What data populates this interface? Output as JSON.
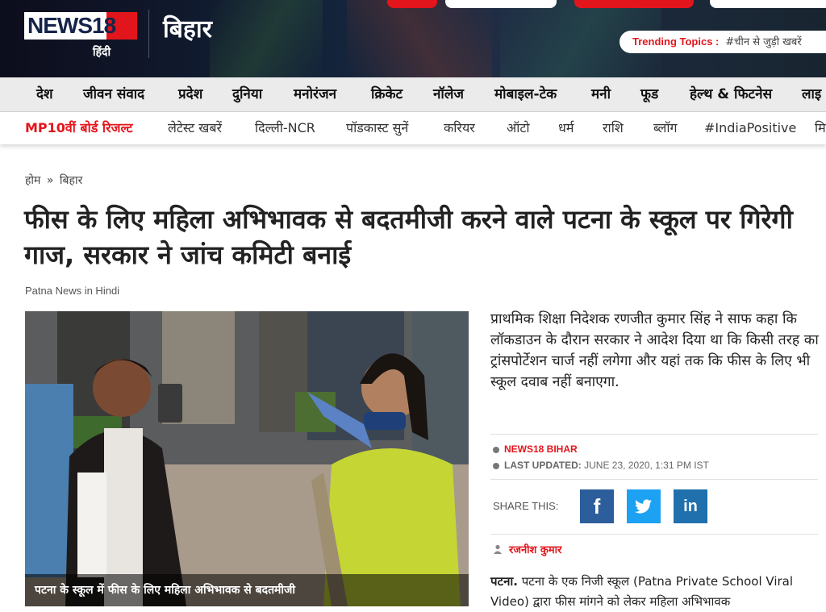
{
  "header": {
    "logo_text": "NEWS18",
    "logo_sub": "हिंदी",
    "section_title": "बिहार",
    "trending_label": "Trending Topics :",
    "trending_text": "#चीन से जुड़ी खबरें"
  },
  "nav_primary": [
    "देश",
    "जीवन संवाद",
    "प्रदेश",
    "दुनिया",
    "मनोरंजन",
    "क्रिकेट",
    "नॉलेज",
    "मोबाइल-टेक",
    "मनी",
    "फूड",
    "हेल्थ & फिटनेस",
    "लाइ"
  ],
  "nav_secondary": [
    "MP10वीं बोर्ड रिजल्ट",
    "लेटेस्ट खबरें",
    "दिल्ली-NCR",
    "पॉडकास्ट सुनें",
    "करियर",
    "ऑटो",
    "धर्म",
    "राशि",
    "ब्लॉग",
    "#IndiaPositive",
    "मि"
  ],
  "breadcrumb": {
    "home": "होम",
    "separator": "»",
    "current": "बिहार"
  },
  "article": {
    "headline": "फीस के लिए महिला अभिभावक से बदतमीजी करने वाले पटना के स्कूल पर गिरेगी गाज, सरकार ने जांच कमिटी बनाई",
    "tag": "Patna News in Hindi",
    "image_caption": "पटना के स्कूल में फीस के लिए महिला अभिभावक से बदतमीजी",
    "summary": "प्राथमिक शिक्षा निदेशक रणजीत कुमार सिंह ने साफ कहा कि लॉकडाउन के दौरान सरकार ने आदेश दिया था कि किसी तरह का ट्रांसपोर्टेशन चार्ज नहीं लगेगा और यहां तक कि फीस के लिए भी स्कूल दवाब नहीं बनाएगा.",
    "source": "NEWS18 BIHAR",
    "updated_label": "LAST UPDATED:",
    "updated_value": "JUNE 23, 2020, 1:31 PM IST",
    "share_label": "SHARE THIS:",
    "author": "रजनीश कुमार",
    "body_lead": "पटना.",
    "body_text": "पटना के एक निजी स्कूल (Patna Private School Viral Video) द्वारा फीस मांगने को लेकर महिला अभिभावक"
  },
  "share": {
    "facebook_glyph": "f",
    "linkedin_glyph": "in",
    "facebook_color": "#2d5e9c",
    "twitter_color": "#1da1f2",
    "linkedin_color": "#1f70ad"
  },
  "colors": {
    "brand_red": "#e3151c",
    "header_dark": "#13233a"
  }
}
